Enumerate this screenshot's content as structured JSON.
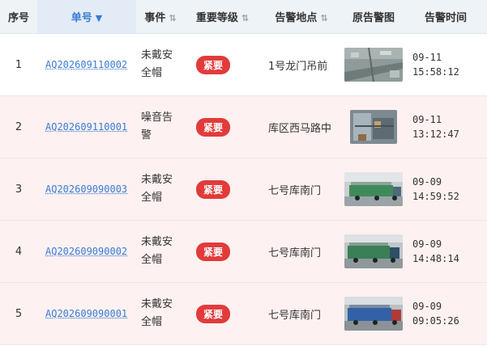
{
  "columns": {
    "index": "序号",
    "number": "单号",
    "event": "事件",
    "level": "重要等级",
    "location": "告警地点",
    "image": "原告警图",
    "time": "告警时间"
  },
  "icons": {
    "sort_active": "caret-down-icon",
    "sort_inactive": "sort-arrows-icon"
  },
  "colors": {
    "accent": "#3a7bd5",
    "urgent_badge": "#e23b3b",
    "header_bg": "#eef3f8",
    "row_tint": "#fdf1f1"
  },
  "rows": [
    {
      "index": "1",
      "number": "AQ202609110002",
      "event": "未戴安全帽",
      "level": "紧要",
      "location": "1号龙门吊前",
      "image": "aerial-yard-photo",
      "date": "09-11",
      "clock": "15:58:12"
    },
    {
      "index": "2",
      "number": "AQ202609110001",
      "event": "噪音告警",
      "level": "紧要",
      "location": "库区西马路中",
      "image": "machinery-photo",
      "date": "09-11",
      "clock": "13:12:47"
    },
    {
      "index": "3",
      "number": "AQ202609090003",
      "event": "未戴安全帽",
      "level": "紧要",
      "location": "七号库南门",
      "image": "truck-green-photo",
      "date": "09-09",
      "clock": "14:59:52"
    },
    {
      "index": "4",
      "number": "AQ202609090002",
      "event": "未戴安全帽",
      "level": "紧要",
      "location": "七号库南门",
      "image": "truck-green-photo",
      "date": "09-09",
      "clock": "14:48:14"
    },
    {
      "index": "5",
      "number": "AQ202609090001",
      "event": "未戴安全帽",
      "level": "紧要",
      "location": "七号库南门",
      "image": "truck-blue-photo",
      "date": "09-09",
      "clock": "09:05:26"
    }
  ]
}
